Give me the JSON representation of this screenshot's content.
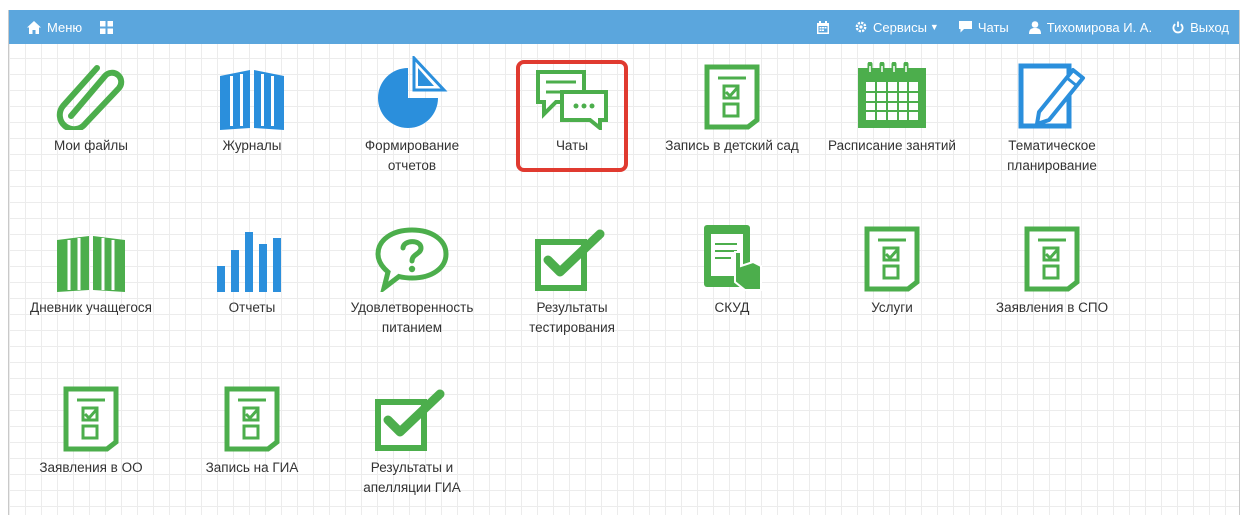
{
  "navbar": {
    "menu_label": "Меню",
    "services_label": "Сервисы",
    "chats_label": "Чаты",
    "user_label": "Тихомирова И. А.",
    "logout_label": "Выход",
    "background_color": "#5ba6dd"
  },
  "tiles": [
    {
      "label": "Мои файлы",
      "icon": "paperclip-icon"
    },
    {
      "label": "Журналы",
      "icon": "book-icon"
    },
    {
      "label": "Формирование отчетов",
      "icon": "pie-chart-icon"
    },
    {
      "label": "Чаты",
      "icon": "chat-bubbles-icon"
    },
    {
      "label": "Запись в детский сад",
      "icon": "form-document-icon"
    },
    {
      "label": "Расписание занятий",
      "icon": "calendar-grid-icon"
    },
    {
      "label": "Тематическое планирование",
      "icon": "pencil-document-icon"
    },
    {
      "label": "Дневник учащегося",
      "icon": "open-book-icon"
    },
    {
      "label": "Отчеты",
      "icon": "bar-chart-icon"
    },
    {
      "label": "Удовлетворенность питанием",
      "icon": "question-bubble-icon"
    },
    {
      "label": "Результаты тестирования",
      "icon": "checkbox-icon"
    },
    {
      "label": "СКУД",
      "icon": "tablet-hand-icon"
    },
    {
      "label": "Услуги",
      "icon": "form-document-icon"
    },
    {
      "label": "Заявления в СПО",
      "icon": "form-document-icon"
    },
    {
      "label": "Заявления в ОО",
      "icon": "form-document-icon"
    },
    {
      "label": "Запись на ГИА",
      "icon": "form-document-icon"
    },
    {
      "label": "Результаты и апелляции ГИА",
      "icon": "checkbox-icon"
    }
  ],
  "colors": {
    "green": "#4cae4c",
    "blue": "#2b8fdc",
    "highlight": "#e03a30"
  }
}
